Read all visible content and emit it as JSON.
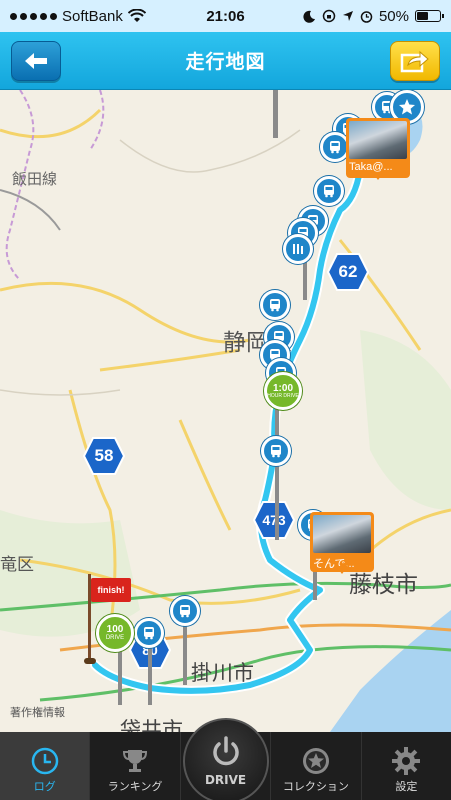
{
  "status_bar": {
    "carrier": "SoftBank",
    "time": "21:06",
    "battery": "50%",
    "battery_level": 0.5
  },
  "header": {
    "title": "走行地図",
    "back_icon": "arrow-left-icon",
    "share_icon": "share-icon"
  },
  "map": {
    "labels": {
      "rail_line": "飯田線",
      "prefecture": "静岡県",
      "city_fujieda": "藤枝市",
      "city_kakegawa": "掛川市",
      "city_fukuroi": "袋井市",
      "ward": "竜区",
      "legal": "著作権情報"
    },
    "routes": [
      "62",
      "58",
      "473",
      "80"
    ],
    "photo_captions": [
      "Taka@...",
      "そんで..."
    ],
    "badges": {
      "hour_top": "1:00",
      "hour_bottom": "HOUR DRIVE",
      "km_top": "100",
      "km_bottom": "DRIVE"
    },
    "finish_label": "finish!",
    "route_color": "#33c6f0"
  },
  "tabs": [
    {
      "label": "ログ",
      "icon": "clock-icon"
    },
    {
      "label": "ランキング",
      "icon": "trophy-icon"
    },
    {
      "label": "DRIVE",
      "icon": "power-icon"
    },
    {
      "label": "コレクション",
      "icon": "star-medal-icon"
    },
    {
      "label": "設定",
      "icon": "gear-icon"
    }
  ]
}
